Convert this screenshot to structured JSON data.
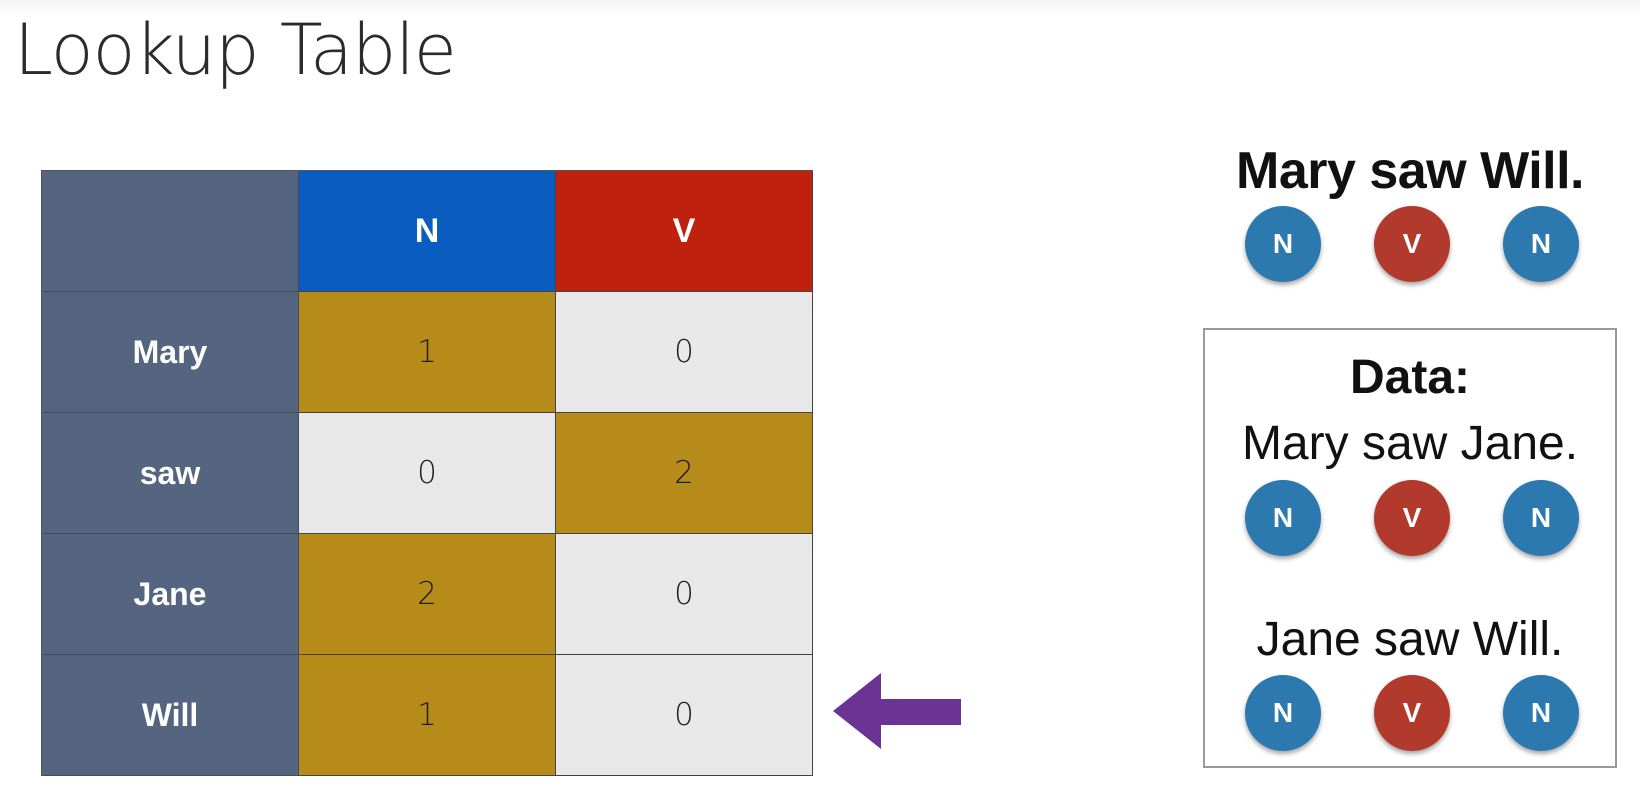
{
  "title": "Lookup Table",
  "table": {
    "columns": [
      "N",
      "V"
    ],
    "column_colors": [
      "#0a5cbf",
      "#be220e"
    ],
    "rows": [
      {
        "word": "Mary",
        "values": [
          "1",
          "0"
        ],
        "max_index": 0
      },
      {
        "word": "saw",
        "values": [
          "0",
          "2"
        ],
        "max_index": 1
      },
      {
        "word": "Jane",
        "values": [
          "2",
          "0"
        ],
        "max_index": 0
      },
      {
        "word": "Will",
        "values": [
          "1",
          "0"
        ],
        "max_index": 0
      }
    ],
    "highlight_color": "#b78b1a",
    "rowhead_color": "#556580"
  },
  "arrow": {
    "icon": "left-arrow-icon",
    "color": "#6b3494",
    "points_to_row": "Will"
  },
  "query": {
    "sentence": "Mary saw Will.",
    "tags": [
      "N",
      "V",
      "N"
    ]
  },
  "data": {
    "heading": "Data:",
    "sentences": [
      {
        "text": "Mary saw Jane.",
        "tags": [
          "N",
          "V",
          "N"
        ]
      },
      {
        "text": "Jane saw Will.",
        "tags": [
          "N",
          "V",
          "N"
        ]
      }
    ]
  },
  "tag_colors": {
    "N": "#2c79b0",
    "V": "#b23a2c"
  }
}
